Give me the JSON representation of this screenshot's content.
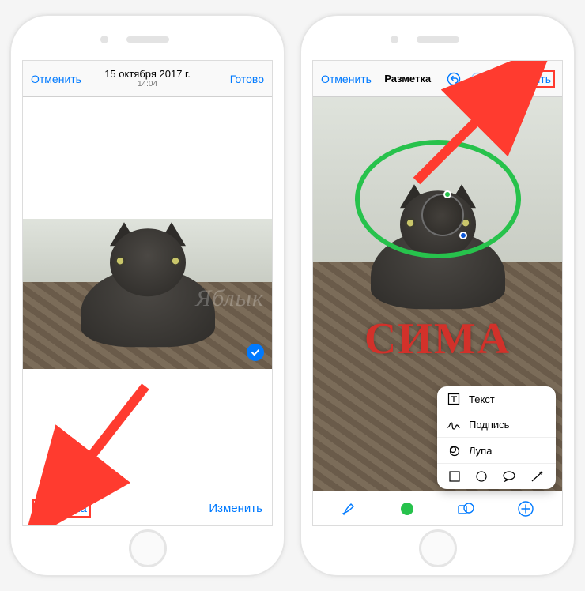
{
  "left": {
    "nav": {
      "cancel": "Отменить",
      "title": "15 октября 2017 г.",
      "subtitle": "14:04",
      "done": "Готово"
    },
    "bottom": {
      "markup": "Разметка",
      "edit": "Изменить"
    }
  },
  "right": {
    "nav": {
      "cancel": "Отменить",
      "title": "Разметка",
      "save": "Сохранить"
    },
    "overlay_text": "СИМА",
    "popover": {
      "text": "Текст",
      "signature": "Подпись",
      "magnifier": "Лупа"
    },
    "toolbar": {
      "color": "#27c24c"
    }
  },
  "watermark": "Яблык"
}
